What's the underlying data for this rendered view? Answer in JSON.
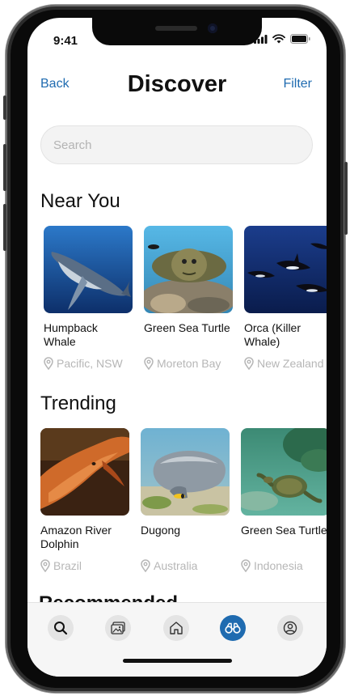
{
  "status": {
    "time": "9:41"
  },
  "header": {
    "back_label": "Back",
    "title": "Discover",
    "filter_label": "Filter"
  },
  "search": {
    "placeholder": "Search",
    "value": ""
  },
  "near_you": {
    "title": "Near You",
    "items": [
      {
        "name": "Humpback Whale",
        "location": "Pacific, NSW"
      },
      {
        "name": "Green Sea Turtle",
        "location": "Moreton Bay"
      },
      {
        "name": "Orca (Killer Whale)",
        "location": "New Zealand"
      }
    ]
  },
  "trending": {
    "title": "Trending",
    "items": [
      {
        "name": "Amazon River Dolphin",
        "location": "Brazil"
      },
      {
        "name": "Dugong",
        "location": "Australia"
      },
      {
        "name": "Green Sea Turtle",
        "location": "Indonesia"
      }
    ]
  },
  "recommended": {
    "title": "Recommended"
  },
  "tabbar": {
    "tabs": [
      {
        "name": "search",
        "icon": "search-icon"
      },
      {
        "name": "gallery",
        "icon": "gallery-icon"
      },
      {
        "name": "home",
        "icon": "home-icon"
      },
      {
        "name": "discover",
        "icon": "binoculars-icon",
        "active": true
      },
      {
        "name": "profile",
        "icon": "profile-icon"
      }
    ]
  },
  "colors": {
    "accent": "#1f6bb0",
    "muted": "#b6b6b6"
  }
}
